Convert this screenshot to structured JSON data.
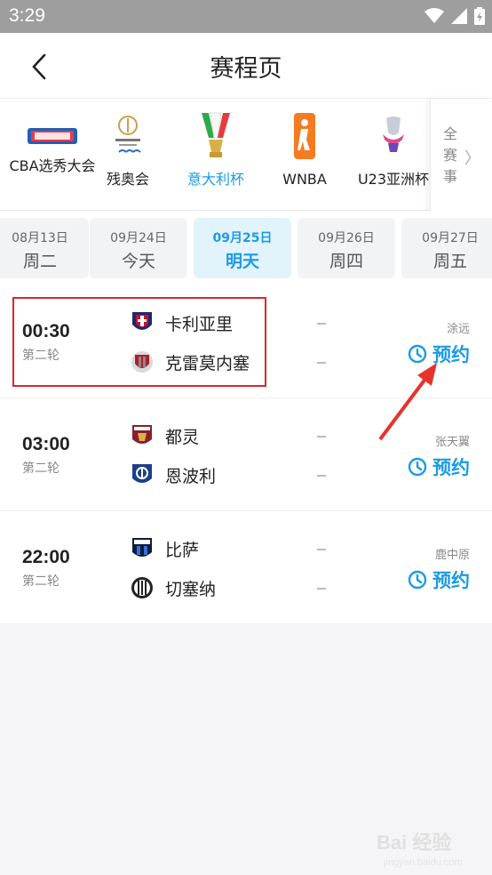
{
  "status_bar": {
    "time": "3:29"
  },
  "header": {
    "title": "赛程页"
  },
  "leagues": [
    {
      "label": "CBA选秀大会",
      "logo": "cba-draft-logo"
    },
    {
      "label": "残奥会",
      "logo": "paralympics-logo"
    },
    {
      "label": "意大利杯",
      "logo": "coppa-italia-logo",
      "active": true
    },
    {
      "label": "WNBA",
      "logo": "wnba-logo"
    },
    {
      "label": "U23亚洲杯",
      "logo": "u23-asian-cup-logo"
    }
  ],
  "all_tab": {
    "label": "全赛事"
  },
  "dates": [
    {
      "date": "08月13日",
      "weekday": "周二"
    },
    {
      "date": "09月24日",
      "weekday": "今天"
    },
    {
      "date": "09月25日",
      "weekday": "明天",
      "active": true
    },
    {
      "date": "09月26日",
      "weekday": "周四"
    },
    {
      "date": "09月27日",
      "weekday": "周五"
    }
  ],
  "matches": [
    {
      "time": "00:30",
      "round": "第二轮",
      "home": "卡利亚里",
      "away": "克雷莫内塞",
      "referee": "涂远",
      "action": "预约"
    },
    {
      "time": "03:00",
      "round": "第二轮",
      "home": "都灵",
      "away": "恩波利",
      "referee": "张天翼",
      "action": "预约"
    },
    {
      "time": "22:00",
      "round": "第二轮",
      "home": "比萨",
      "away": "切塞纳",
      "referee": "鹿中原",
      "action": "预约"
    }
  ],
  "watermark": {
    "brand": "Bai 经验",
    "site": "jingyan.baidu.com"
  },
  "colors": {
    "accent": "#1b9be6",
    "highlight": "#d9262e"
  }
}
